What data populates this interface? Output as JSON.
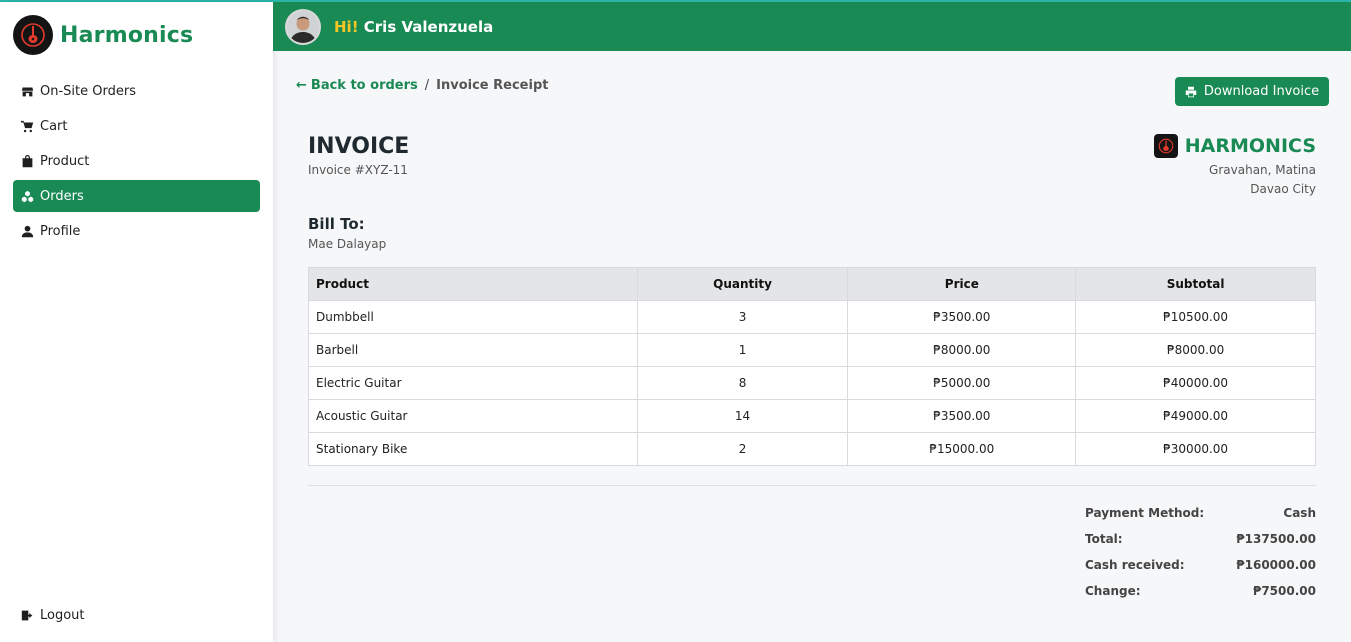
{
  "brand": {
    "name": "Harmonics"
  },
  "sidebar": {
    "items": [
      {
        "label": "On-Site Orders",
        "icon": "store-icon",
        "active": false
      },
      {
        "label": "Cart",
        "icon": "cart-icon",
        "active": false
      },
      {
        "label": "Product",
        "icon": "bag-icon",
        "active": false
      },
      {
        "label": "Orders",
        "icon": "orders-icon",
        "active": true
      },
      {
        "label": "Profile",
        "icon": "user-icon",
        "active": false
      }
    ],
    "logout_label": "Logout"
  },
  "header": {
    "hi": "Hi!",
    "user_name": "Cris Valenzuela"
  },
  "breadcrumb": {
    "back_label": "Back to orders",
    "separator": "/",
    "current": "Invoice Receipt"
  },
  "toolbar": {
    "download_label": "Download Invoice"
  },
  "invoice": {
    "title": "INVOICE",
    "number": "Invoice #XYZ-11",
    "company_name": "HARMONICS",
    "address_line1": "Gravahan, Matina",
    "address_line2": "Davao City",
    "bill_to_label": "Bill To:",
    "bill_to_name": "Mae Dalayap"
  },
  "table": {
    "headers": [
      "Product",
      "Quantity",
      "Price",
      "Subtotal"
    ],
    "rows": [
      [
        "Dumbbell",
        "3",
        "₱3500.00",
        "₱10500.00"
      ],
      [
        "Barbell",
        "1",
        "₱8000.00",
        "₱8000.00"
      ],
      [
        "Electric Guitar",
        "8",
        "₱5000.00",
        "₱40000.00"
      ],
      [
        "Acoustic Guitar",
        "14",
        "₱3500.00",
        "₱49000.00"
      ],
      [
        "Stationary Bike",
        "2",
        "₱15000.00",
        "₱30000.00"
      ]
    ]
  },
  "summary": {
    "payment_method_label": "Payment Method:",
    "payment_method": "Cash",
    "total_label": "Total:",
    "total": "₱137500.00",
    "cash_received_label": "Cash received:",
    "cash_received": "₱160000.00",
    "change_label": "Change:",
    "change": "₱7500.00"
  },
  "colors": {
    "accent": "#1a8a55",
    "greeting_highlight": "#f3c623",
    "top_border": "#2bb5a8"
  }
}
